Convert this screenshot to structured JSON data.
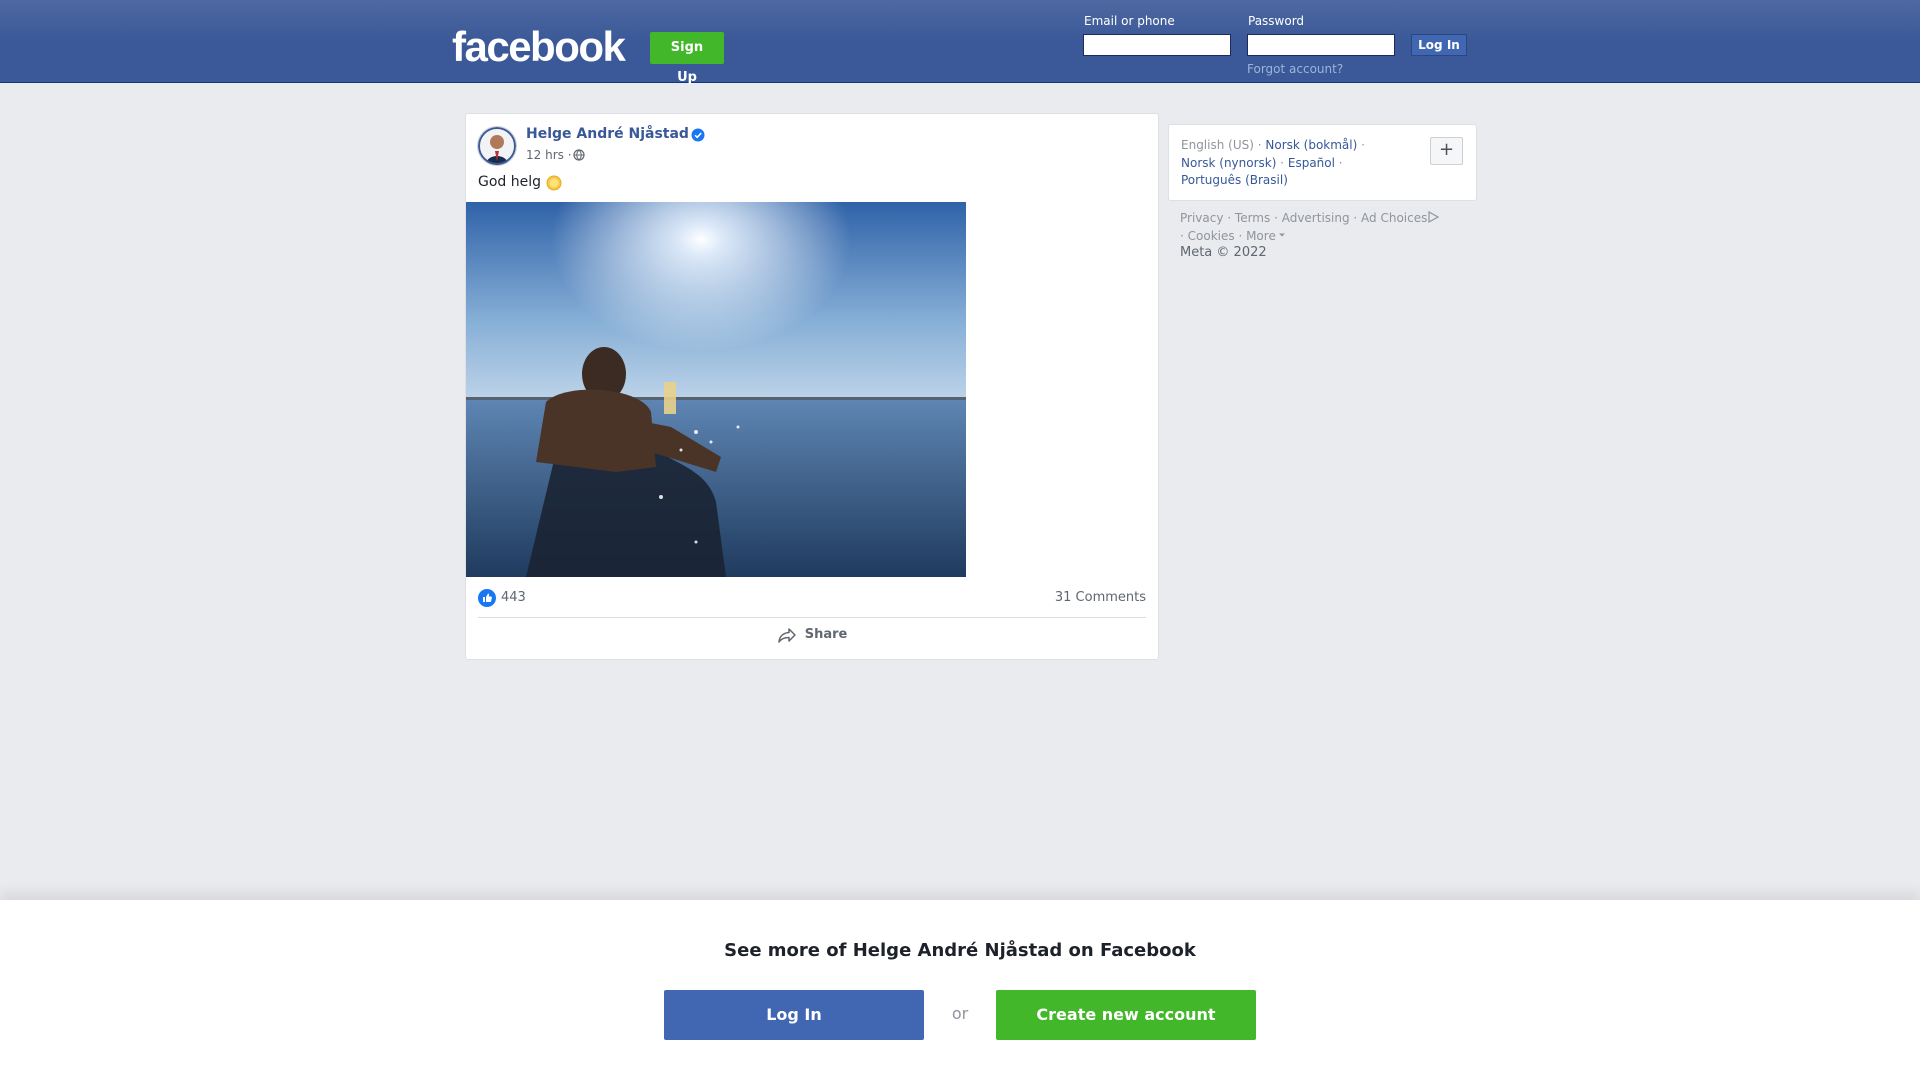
{
  "header": {
    "logo_text": "facebook",
    "signup_label": "Sign Up",
    "email_label": "Email or phone",
    "email_value": "",
    "password_label": "Password",
    "password_value": "",
    "login_label": "Log In",
    "forgot_label": "Forgot account?"
  },
  "post": {
    "author": "Helge André Njåstad",
    "verified": true,
    "time": "12 hrs ·",
    "privacy_icon": "globe-icon",
    "text": "God helg",
    "emoji": "sun-emoji",
    "photo_description": "photo",
    "like_count": "443",
    "comments_label": "31 Comments",
    "share_label": "Share"
  },
  "languages": {
    "current": "English (US)",
    "items": [
      "Norsk (bokmål)",
      "Norsk (nynorsk)",
      "Español",
      "Português (Brasil)"
    ],
    "more_button": "+"
  },
  "footer": {
    "links": [
      "Privacy",
      "Terms",
      "Advertising",
      "Ad Choices",
      "Cookies",
      "More"
    ],
    "copyright": "Meta © 2022"
  },
  "bottom": {
    "title": "See more of Helge André Njåstad on Facebook",
    "login_label": "Log In",
    "or_label": "or",
    "create_label": "Create new account"
  },
  "colors": {
    "brand_blue": "#3b5998",
    "button_blue": "#4267b2",
    "green": "#42b72a"
  }
}
